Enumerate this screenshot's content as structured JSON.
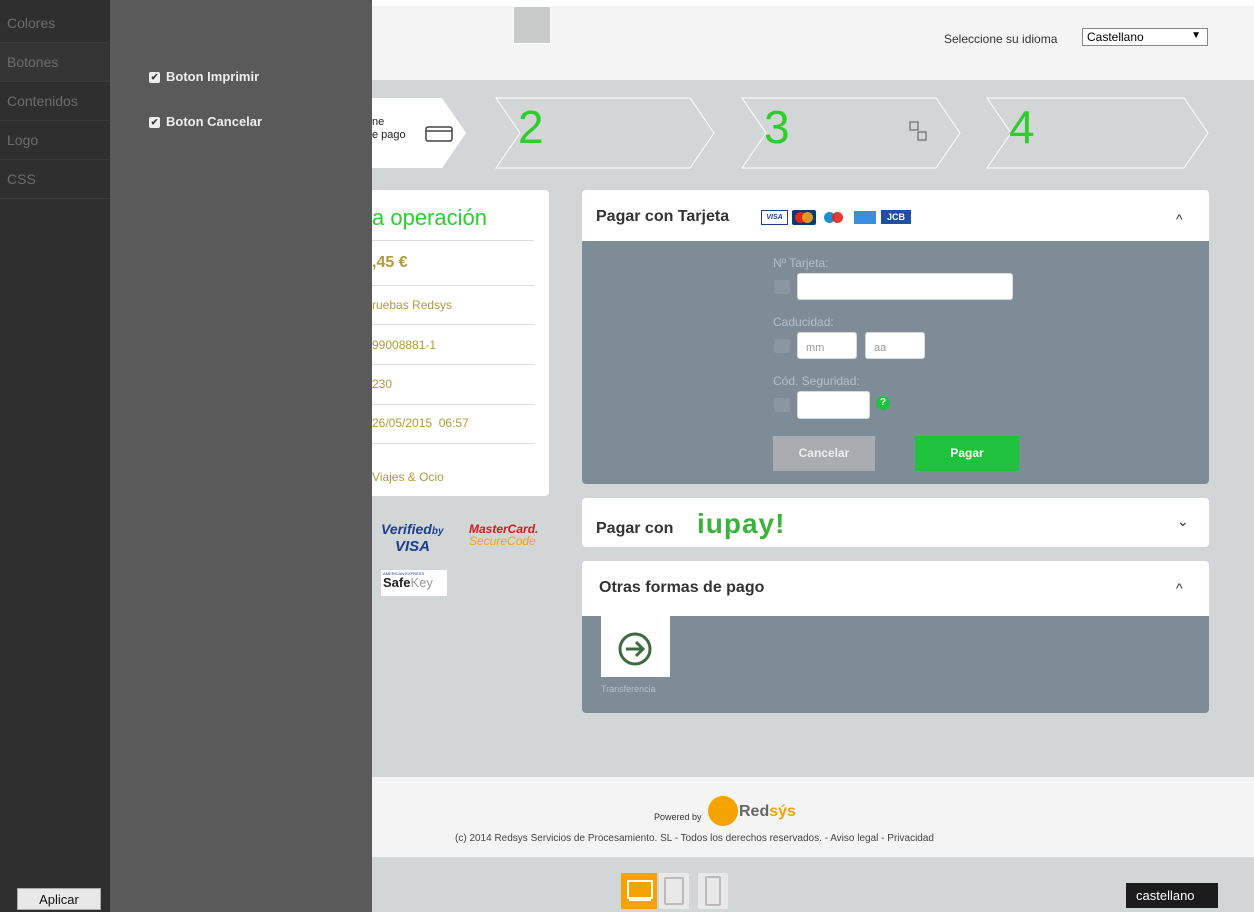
{
  "header": {
    "language_label": "Seleccione su idioma",
    "language_value": "Castellano"
  },
  "steps": {
    "step1_text": "Selección de medio de pago",
    "step1_visible_line1": "ne",
    "step1_visible_line2": "e pago",
    "step2": "2",
    "step3": "3",
    "step4": "4"
  },
  "operation": {
    "title": "a operación",
    "amount": ",45 €",
    "merchant": "ruebas Redsys",
    "terminal": "99008881-1",
    "order": "230",
    "date": "26/05/2015",
    "time": "06:57",
    "description": "Viajes & Ocio"
  },
  "security_logos": {
    "verified_visa_1": "Verified",
    "verified_visa_by": "by",
    "verified_visa_2": "VISA",
    "mastercard_1": "MasterCard.",
    "mastercard_2": "SecureCode",
    "safekey_top": "AMERICAN EXPRESS",
    "safekey_1": "Safe",
    "safekey_2": "Key"
  },
  "card_payment": {
    "title": "Pagar con Tarjeta",
    "brands": [
      "VISA",
      "MasterCard",
      "Maestro",
      "Amex",
      "JCB"
    ],
    "card_number_label": "Nº Tarjeta:",
    "card_number_value": "",
    "expiry_label": "Caducidad:",
    "month_placeholder": "mm",
    "year_placeholder": "aa",
    "cvv_label": "Cód. Seguridad:",
    "cvv_help": "?",
    "cancel_label": "Cancelar",
    "pay_label": "Pagar",
    "chevron": "^"
  },
  "iupay": {
    "title": "Pagar con",
    "logo": "iupay!",
    "chevron": "⌄"
  },
  "other_methods": {
    "title": "Otras formas de pago",
    "chevron": "^",
    "transfer_label": "Transferencia"
  },
  "footer": {
    "powered_by": "Powered by",
    "brand_1": "Red",
    "brand_2": "sýs",
    "copyright": "(c) 2014 Redsys Servicios de Procesamiento. SL - Todos los derechos reservados. -",
    "legal": "Aviso legal",
    "privacy": "Privacidad",
    "sep": "-"
  },
  "bottom": {
    "language_button": "castellano"
  },
  "editor": {
    "menu": [
      "Colores",
      "Botones",
      "Contenidos",
      "Logo",
      "CSS"
    ],
    "checkbox_print": "Boton Imprimir",
    "checkbox_cancel": "Boton Cancelar",
    "apply_label": "Aplicar"
  },
  "colors": {
    "accent_green": "#2ecc2e",
    "pay_button": "#1ec23c",
    "form_bg": "#7e8c98",
    "detail_text": "#b09a3a"
  }
}
